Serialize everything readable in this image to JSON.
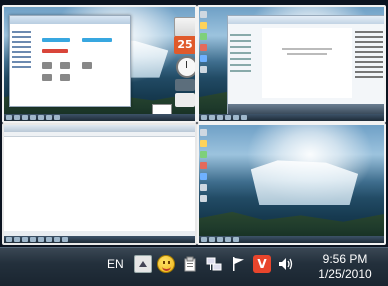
{
  "screen": {
    "quadrants": [
      {
        "name": "Windows Explorer desktop"
      },
      {
        "name": "Windows Media Player desktop"
      },
      {
        "name": "Web browser desktop"
      },
      {
        "name": "Empty desktop"
      }
    ],
    "gadgets": {
      "calendar_day": "25"
    }
  },
  "taskbar": {
    "language": "EN",
    "tray_icons": [
      "show-hidden-icons",
      "smiley-icon",
      "clipboard-icon",
      "network-icon",
      "action-center-flag-icon",
      "v-app-icon",
      "speaker-icon"
    ],
    "v_label": "V",
    "time": "9:56 PM",
    "date": "1/25/2010"
  },
  "colors": {
    "taskbar": "#23303c",
    "accent_red": "#e8452c"
  }
}
